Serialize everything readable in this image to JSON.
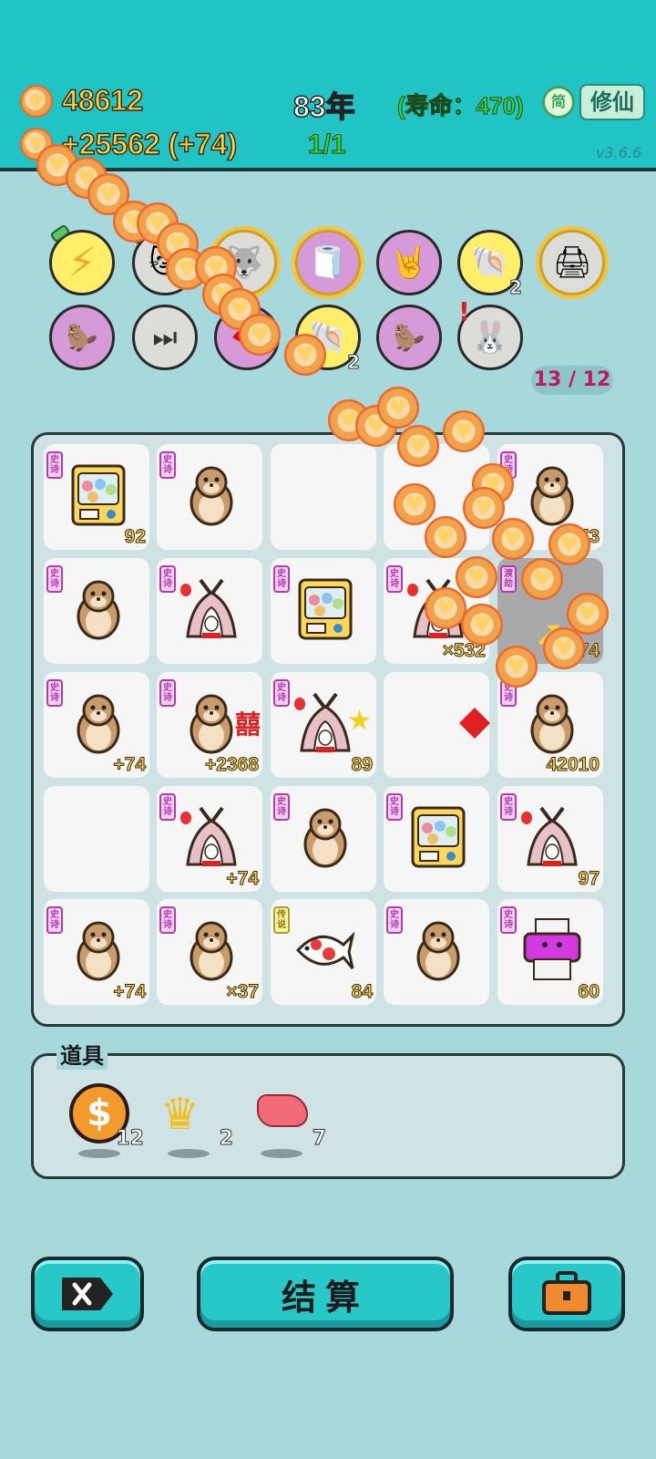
{
  "header": {
    "coins": "48612",
    "income": "+25562 (+74)",
    "year": "83年",
    "progress": "1/1",
    "lifespan": "(寿命：470)",
    "simplified_label": "简",
    "mode_label": "修仙",
    "version": "v3.6.6"
  },
  "relics": {
    "count": "13 / 12",
    "shell_badge_1": "2",
    "shell_badge_2": "2"
  },
  "board": {
    "cells": [
      {
        "tag": "史诗",
        "num": "92"
      },
      {
        "tag": "史诗",
        "num": ""
      },
      {
        "tag": "",
        "num": ""
      },
      {
        "tag": "",
        "num": ""
      },
      {
        "tag": "史诗",
        "num": "73"
      },
      {
        "tag": "史诗",
        "num": ""
      },
      {
        "tag": "史诗",
        "num": ""
      },
      {
        "tag": "史诗",
        "num": ""
      },
      {
        "tag": "史诗",
        "num": "×532"
      },
      {
        "tag": "渡劫",
        "num": "+74"
      },
      {
        "tag": "史诗",
        "num": "+74"
      },
      {
        "tag": "史诗",
        "num": "+2368"
      },
      {
        "tag": "史诗",
        "num": "89"
      },
      {
        "tag": "",
        "num": ""
      },
      {
        "tag": "史诗",
        "num": "42010"
      },
      {
        "tag": "",
        "num": ""
      },
      {
        "tag": "史诗",
        "num": "+74"
      },
      {
        "tag": "史诗",
        "num": ""
      },
      {
        "tag": "史诗",
        "num": ""
      },
      {
        "tag": "史诗",
        "num": "97"
      },
      {
        "tag": "史诗",
        "num": "+74"
      },
      {
        "tag": "史诗",
        "num": "×37"
      },
      {
        "tag": "传说",
        "num": "84"
      },
      {
        "tag": "史诗",
        "num": ""
      },
      {
        "tag": "史诗",
        "num": "60"
      }
    ]
  },
  "items": {
    "title": "道具",
    "list": [
      {
        "icon": "coin-dollar-icon",
        "count": "12"
      },
      {
        "icon": "crown-icon",
        "count": "2"
      },
      {
        "icon": "liver-icon",
        "count": "7"
      }
    ]
  },
  "buttons": {
    "settle": "结算"
  }
}
